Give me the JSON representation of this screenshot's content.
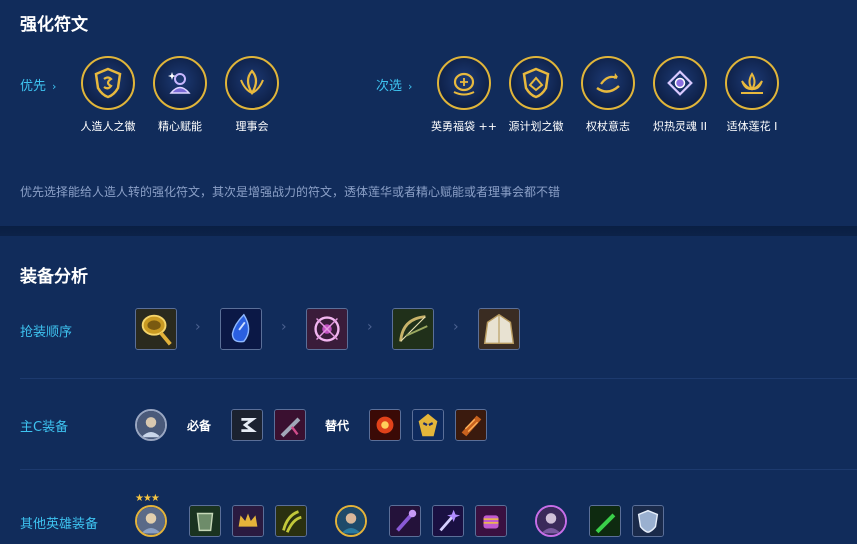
{
  "augments": {
    "title": "强化符文",
    "priority_label": "优先",
    "secondary_label": "次选",
    "chevron": "›",
    "priority": [
      {
        "name": "人造人之徽",
        "icon": "shield-crest-icon"
      },
      {
        "name": "精心赋能",
        "icon": "scholar-icon"
      },
      {
        "name": "理事会",
        "icon": "council-icon"
      }
    ],
    "secondary": [
      {
        "name": "英勇福袋 ++",
        "icon": "coin-bag-icon"
      },
      {
        "name": "源计划之徽",
        "icon": "project-crest-icon"
      },
      {
        "name": "权杖意志",
        "icon": "scepter-icon"
      },
      {
        "name": "炽热灵魂 II",
        "icon": "burning-soul-icon"
      },
      {
        "name": "适体莲花 I",
        "icon": "lotus-icon"
      }
    ],
    "note": "优先选择能给人造人转的强化符文，其次是增强战力的符文，透体莲华或者精心赋能或者理事会都不错",
    "accent": "#3ec3f0",
    "ring_color": "#e0b53a"
  },
  "items": {
    "title": "装备分析",
    "order_label": "抢装顺序",
    "arrow": "›",
    "order": [
      {
        "icon": "frying-pan-icon"
      },
      {
        "icon": "tear-icon"
      },
      {
        "icon": "bramble-vest-icon"
      },
      {
        "icon": "bow-icon"
      },
      {
        "icon": "cloak-icon"
      }
    ],
    "main_label": "主C装备",
    "must_label": "必备",
    "alt_label": "替代",
    "main_must": [
      {
        "icon": "emblem-icon"
      },
      {
        "icon": "blade-icon"
      }
    ],
    "main_alt": [
      {
        "icon": "flame-orb-icon"
      },
      {
        "icon": "mask-icon"
      },
      {
        "icon": "gauntlet-icon"
      }
    ],
    "others_label": "其他英雄装备",
    "star_text": "★★★"
  }
}
